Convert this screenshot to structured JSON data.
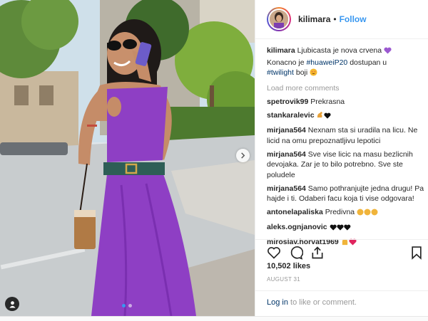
{
  "post": {
    "username": "kilimara",
    "follow_separator": "•",
    "follow_label": "Follow",
    "caption": {
      "username": "kilimara",
      "text_part1": "Ljubicasta je nova crvena",
      "text_part2": "Konacno je",
      "hashtag1": "#huaweiP20",
      "text_part3": "dostupan u",
      "hashtag2": "#twilight",
      "text_part4": "boji"
    },
    "load_more_label": "Load more comments",
    "comments": [
      {
        "username": "spetrovik99",
        "text": "Prekrasna"
      },
      {
        "username": "stankaralevic",
        "text": ""
      },
      {
        "username": "mirjana564",
        "text": "Nexnam sta si uradila na licu. Ne licid na omu prepoznatljivu lepotici"
      },
      {
        "username": "mirjana564",
        "text": "Sve vise licic na masu bezlicnih devojaka. Zar je to bilo potrebno. Sve ste poludele"
      },
      {
        "username": "mirjana564",
        "text": "Samo pothranjujte jedna drugu! Pa hajde i ti. Odaberi facu koja ti vise odgovara!"
      },
      {
        "username": "antonelapaliska",
        "text": "Predivna"
      },
      {
        "username": "aleks.ognjanovic",
        "text": ""
      },
      {
        "username": "miroslav.horvat1969",
        "text": ""
      }
    ],
    "likes": "10,502 likes",
    "date": "AUGUST 31",
    "login_link": "Log in",
    "login_rest": "to like or comment."
  },
  "icons": {
    "like": "heart-icon",
    "comment": "comment-icon",
    "share": "share-icon",
    "save": "bookmark-icon",
    "next": "chevron-right-icon",
    "user_tag": "user-tag-icon"
  },
  "colors": {
    "link_blue": "#3897f0",
    "hashtag_blue": "#003569",
    "dress_purple": "#8e3fc4",
    "muted_gray": "#999999"
  }
}
